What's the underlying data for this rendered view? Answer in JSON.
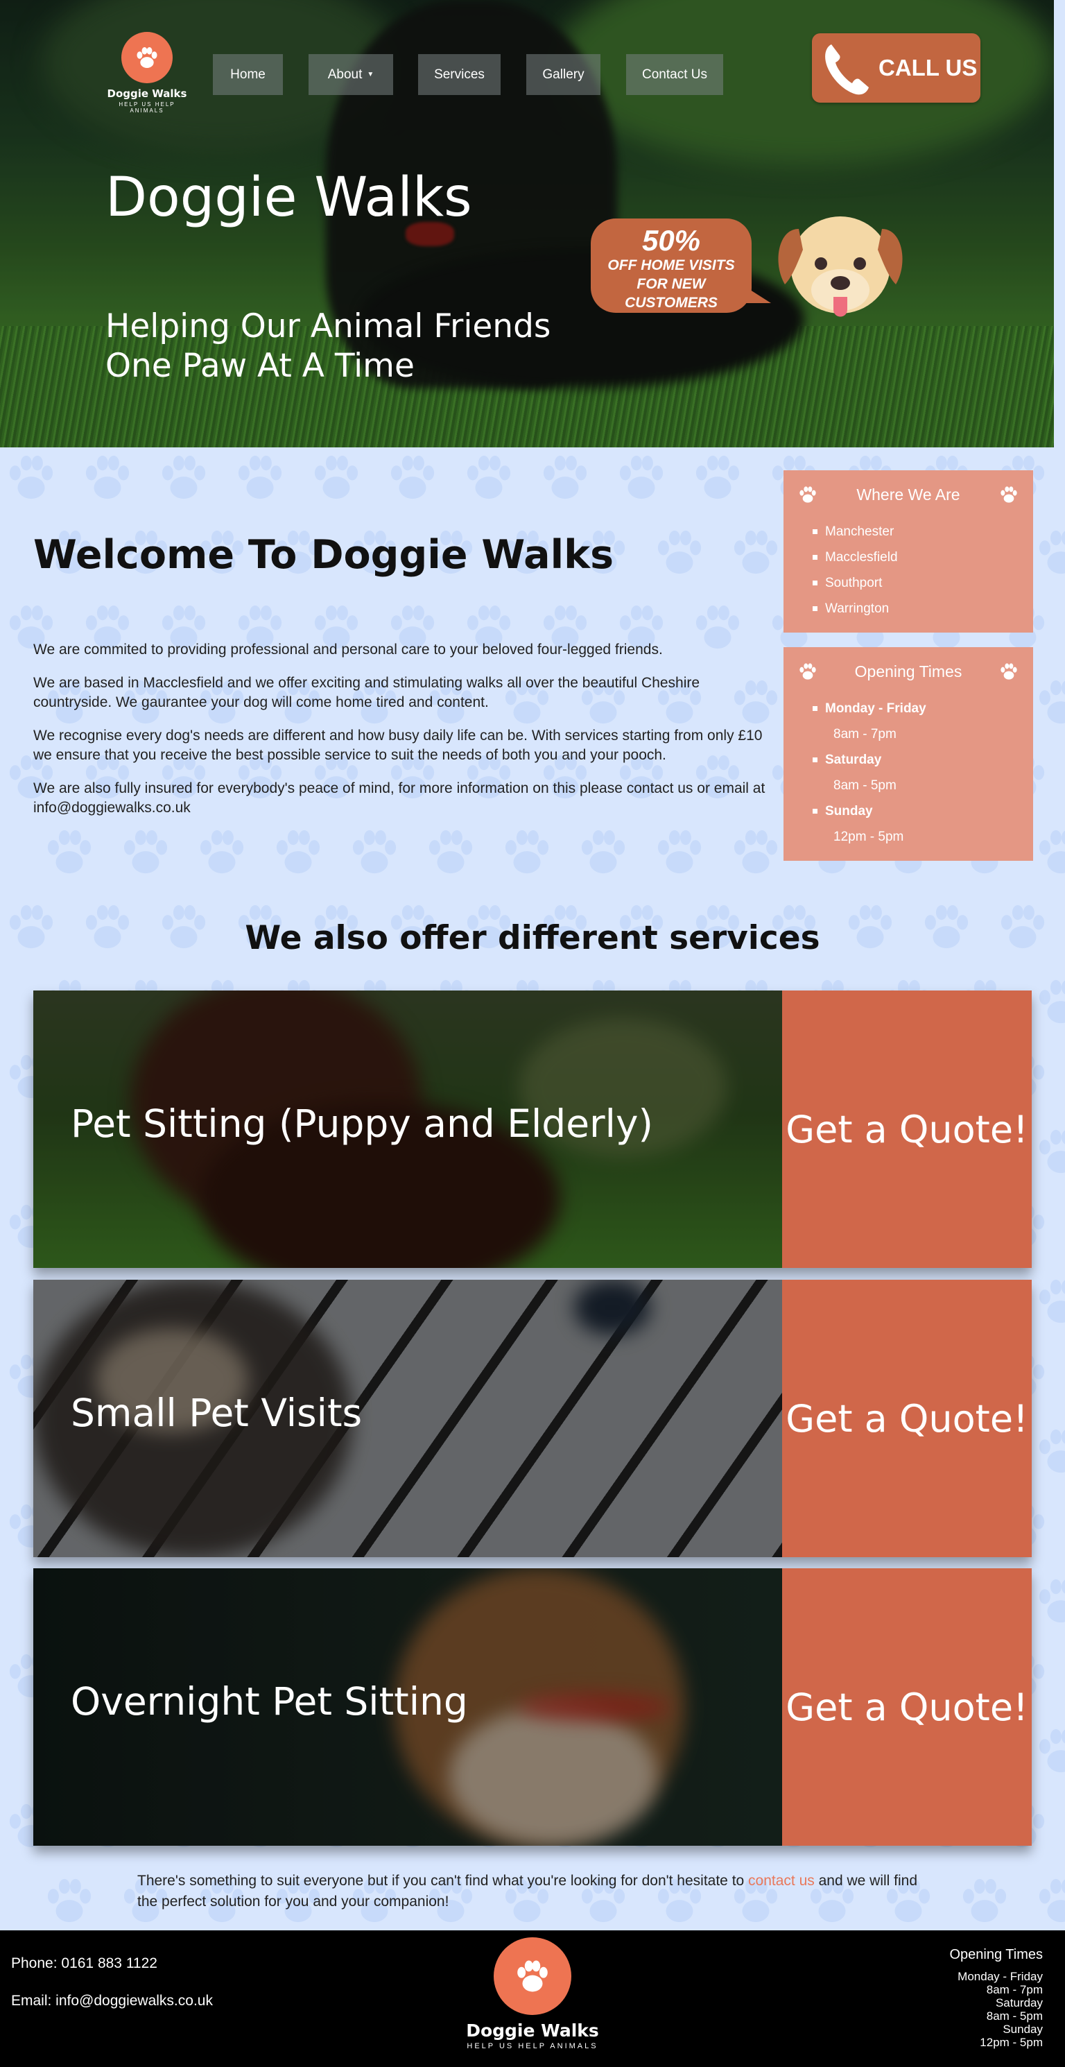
{
  "brand": {
    "name": "Doggie Walks",
    "tagline": "HELP US HELP ANIMALS"
  },
  "nav": {
    "items": [
      {
        "label": "Home"
      },
      {
        "label": "About",
        "has_dropdown": true
      },
      {
        "label": "Services"
      },
      {
        "label": "Gallery"
      },
      {
        "label": "Contact Us"
      }
    ]
  },
  "call_button": {
    "label": "CALL US",
    "icon": "phone-icon"
  },
  "hero": {
    "title": "Doggie Walks",
    "subtitle_line1": "Helping Our Animal Friends",
    "subtitle_line2": "One Paw At A Time"
  },
  "promo": {
    "percent": "50%",
    "line1": "OFF HOME VISITS",
    "line2": "FOR NEW",
    "line3": "CUSTOMERS"
  },
  "welcome": {
    "title": "Welcome To Doggie Walks",
    "paragraphs": [
      "We are commited to providing professional and personal care to your beloved four-legged friends.",
      "We are based in Macclesfield and we offer exciting and stimulating walks all over the beautiful Cheshire countryside. We gaurantee your dog will come home tired and content.",
      "We recognise every dog's needs are different and how busy daily life can be. With services starting from only £10 we ensure that you receive the best possible service to suit the needs of both you and your pooch.",
      "We are also fully insured for everybody's peace of mind, for more information on this please contact us or email at info@doggiewalks.co.uk"
    ]
  },
  "where_we_are": {
    "title": "Where We Are",
    "locations": [
      "Manchester",
      "Macclesfield",
      "Southport",
      "Warrington"
    ]
  },
  "opening_times": {
    "title": "Opening Times",
    "days": [
      {
        "day": "Monday - Friday",
        "hours": "8am - 7pm"
      },
      {
        "day": "Saturday",
        "hours": "8am - 5pm"
      },
      {
        "day": "Sunday",
        "hours": "12pm - 5pm"
      }
    ]
  },
  "services": {
    "title": "We also offer different services",
    "items": [
      {
        "label": "Pet Sitting (Puppy and Elderly)",
        "cta": "Get a Quote!"
      },
      {
        "label": "Small Pet Visits",
        "cta": "Get a Quote!"
      },
      {
        "label": "Overnight Pet Sitting",
        "cta": "Get a Quote!"
      }
    ]
  },
  "closing": {
    "before": "There's something to suit everyone but if you can't find what you're looking for don't hesitate to ",
    "link": "contact us",
    "after": " and we will find the perfect solution for you and your companion!"
  },
  "footer": {
    "phone": "Phone: 0161 883 1122",
    "email": "Email: info@doggiewalks.co.uk",
    "hours_title": "Opening Times",
    "hours": [
      "Monday - Friday",
      "8am - 7pm",
      "Saturday",
      "8am - 5pm",
      "Sunday",
      "12pm - 5pm"
    ]
  },
  "colors": {
    "accent": "#ee7452",
    "quote_bg": "#d0674a",
    "sidebar_bg": "#e49784",
    "page_bg": "#d8e6fd",
    "footer_bg": "#000000"
  }
}
